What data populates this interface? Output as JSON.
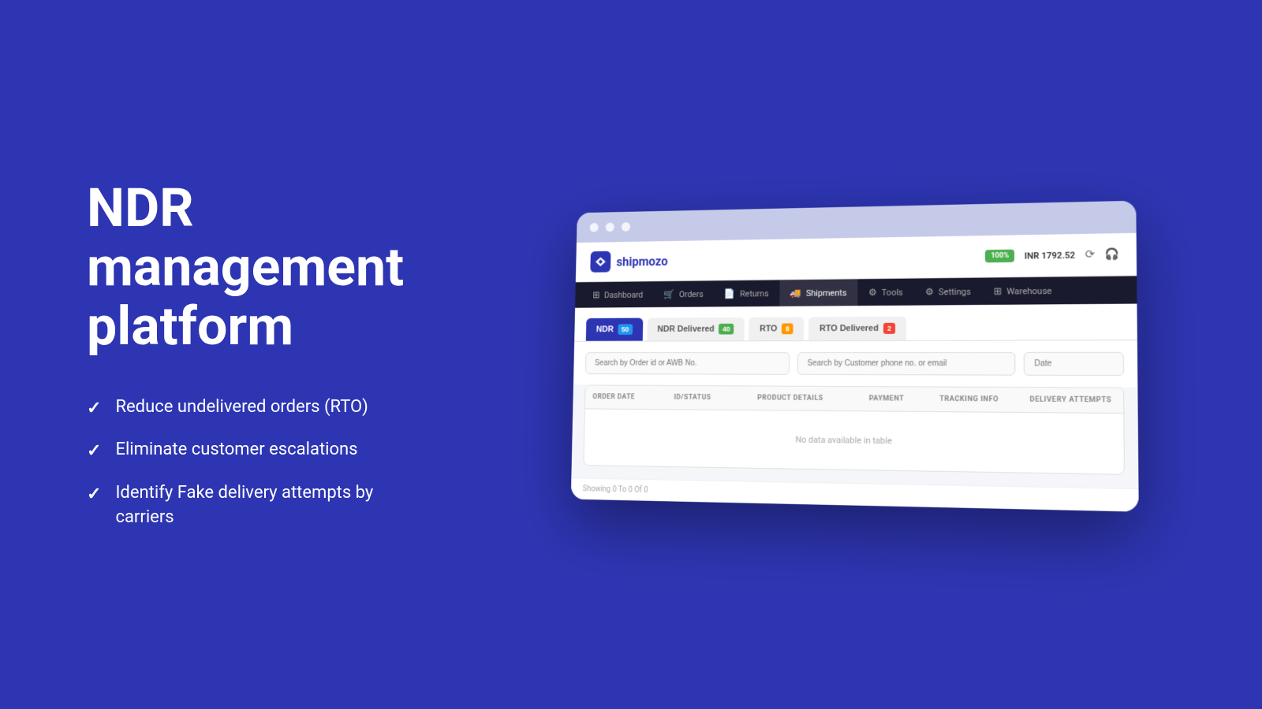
{
  "background_color": "#2d35b3",
  "left": {
    "title_line1": "NDR",
    "title_line2": "management",
    "title_line3": "platform",
    "features": [
      {
        "id": 1,
        "text": "Reduce undelivered orders (RTO)"
      },
      {
        "id": 2,
        "text": "Eliminate customer escalations"
      },
      {
        "id": 3,
        "text": "Identify Fake delivery attempts by carriers"
      }
    ]
  },
  "browser": {
    "logo_text": "shipmozo",
    "balance_badge": "100%",
    "wallet_label": "INR 1792.52",
    "nav_items": [
      {
        "id": "dashboard",
        "label": "Dashboard",
        "icon": "⊞",
        "active": false
      },
      {
        "id": "orders",
        "label": "Orders",
        "icon": "🛒",
        "active": false
      },
      {
        "id": "returns",
        "label": "Returns",
        "icon": "📄",
        "active": false
      },
      {
        "id": "shipments",
        "label": "Shipments",
        "icon": "🚚",
        "active": true
      },
      {
        "id": "tools",
        "label": "Tools",
        "icon": "⚙",
        "active": false
      },
      {
        "id": "settings",
        "label": "Settings",
        "icon": "⚙",
        "active": false
      },
      {
        "id": "warehouse",
        "label": "Warehouse",
        "icon": "⊞",
        "active": false
      }
    ],
    "tabs": [
      {
        "id": "ndr",
        "label": "NDR",
        "badge": "50",
        "badge_color": "badge-blue",
        "active": true
      },
      {
        "id": "ndr-delivered",
        "label": "NDR Delivered",
        "badge": "40",
        "badge_color": "badge-green",
        "active": false
      },
      {
        "id": "rto",
        "label": "RTO",
        "badge": "8",
        "badge_color": "badge-orange",
        "active": false
      },
      {
        "id": "rto-delivered",
        "label": "RTO Delivered",
        "badge": "2",
        "badge_color": "badge-red",
        "active": false
      }
    ],
    "search_placeholder1": "Search by Order id or AWB No.",
    "search_placeholder2": "Search by Customer phone no. or email",
    "date_placeholder": "Date",
    "table_columns": [
      "ORDER DATE",
      "ID/STATUS",
      "PRODUCT DETAILS",
      "PAYMENT",
      "TRACKING INFO",
      "DELIVERY ATTEMPTS"
    ],
    "empty_message": "No data available in table",
    "footer_text": "Showing 0 To 0 Of 0"
  }
}
